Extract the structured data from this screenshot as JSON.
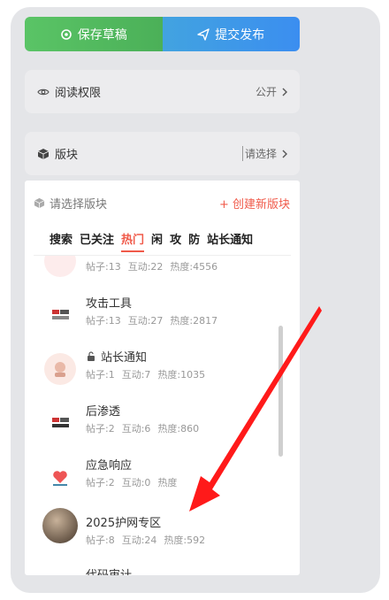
{
  "buttons": {
    "save": "保存草稿",
    "publish": "提交发布"
  },
  "permission": {
    "label": "阅读权限",
    "value": "公开"
  },
  "block": {
    "label": "版块",
    "placeholder": "请选择"
  },
  "dropdown": {
    "title": "请选择版块",
    "create": "+ 创建新版块",
    "tabs": [
      "搜索",
      "已关注",
      "热门",
      "闲",
      "攻",
      "防",
      "站长通知"
    ],
    "active_tab": "热门",
    "items": [
      {
        "name": "",
        "posts": "帖子:13",
        "interact": "互动:22",
        "heat": "热度:4556"
      },
      {
        "name": "攻击工具",
        "posts": "帖子:13",
        "interact": "互动:27",
        "heat": "热度:2817"
      },
      {
        "name": "站长通知",
        "posts": "帖子:1",
        "interact": "互动:7",
        "heat": "热度:1035"
      },
      {
        "name": "后渗透",
        "posts": "帖子:2",
        "interact": "互动:6",
        "heat": "热度:860"
      },
      {
        "name": "应急响应",
        "posts": "帖子:2",
        "interact": "互动:0",
        "heat": "热度"
      },
      {
        "name": "2025护网专区",
        "posts": "帖子:8",
        "interact": "互动:24",
        "heat": "热度:592"
      },
      {
        "name": "代码审计",
        "posts": "",
        "interact": "",
        "heat": ""
      }
    ]
  },
  "colors": {
    "accent": "#f05a4a",
    "save": "#5ac466",
    "publish": "#3b8ef0",
    "arrow": "#ff1a1a"
  }
}
